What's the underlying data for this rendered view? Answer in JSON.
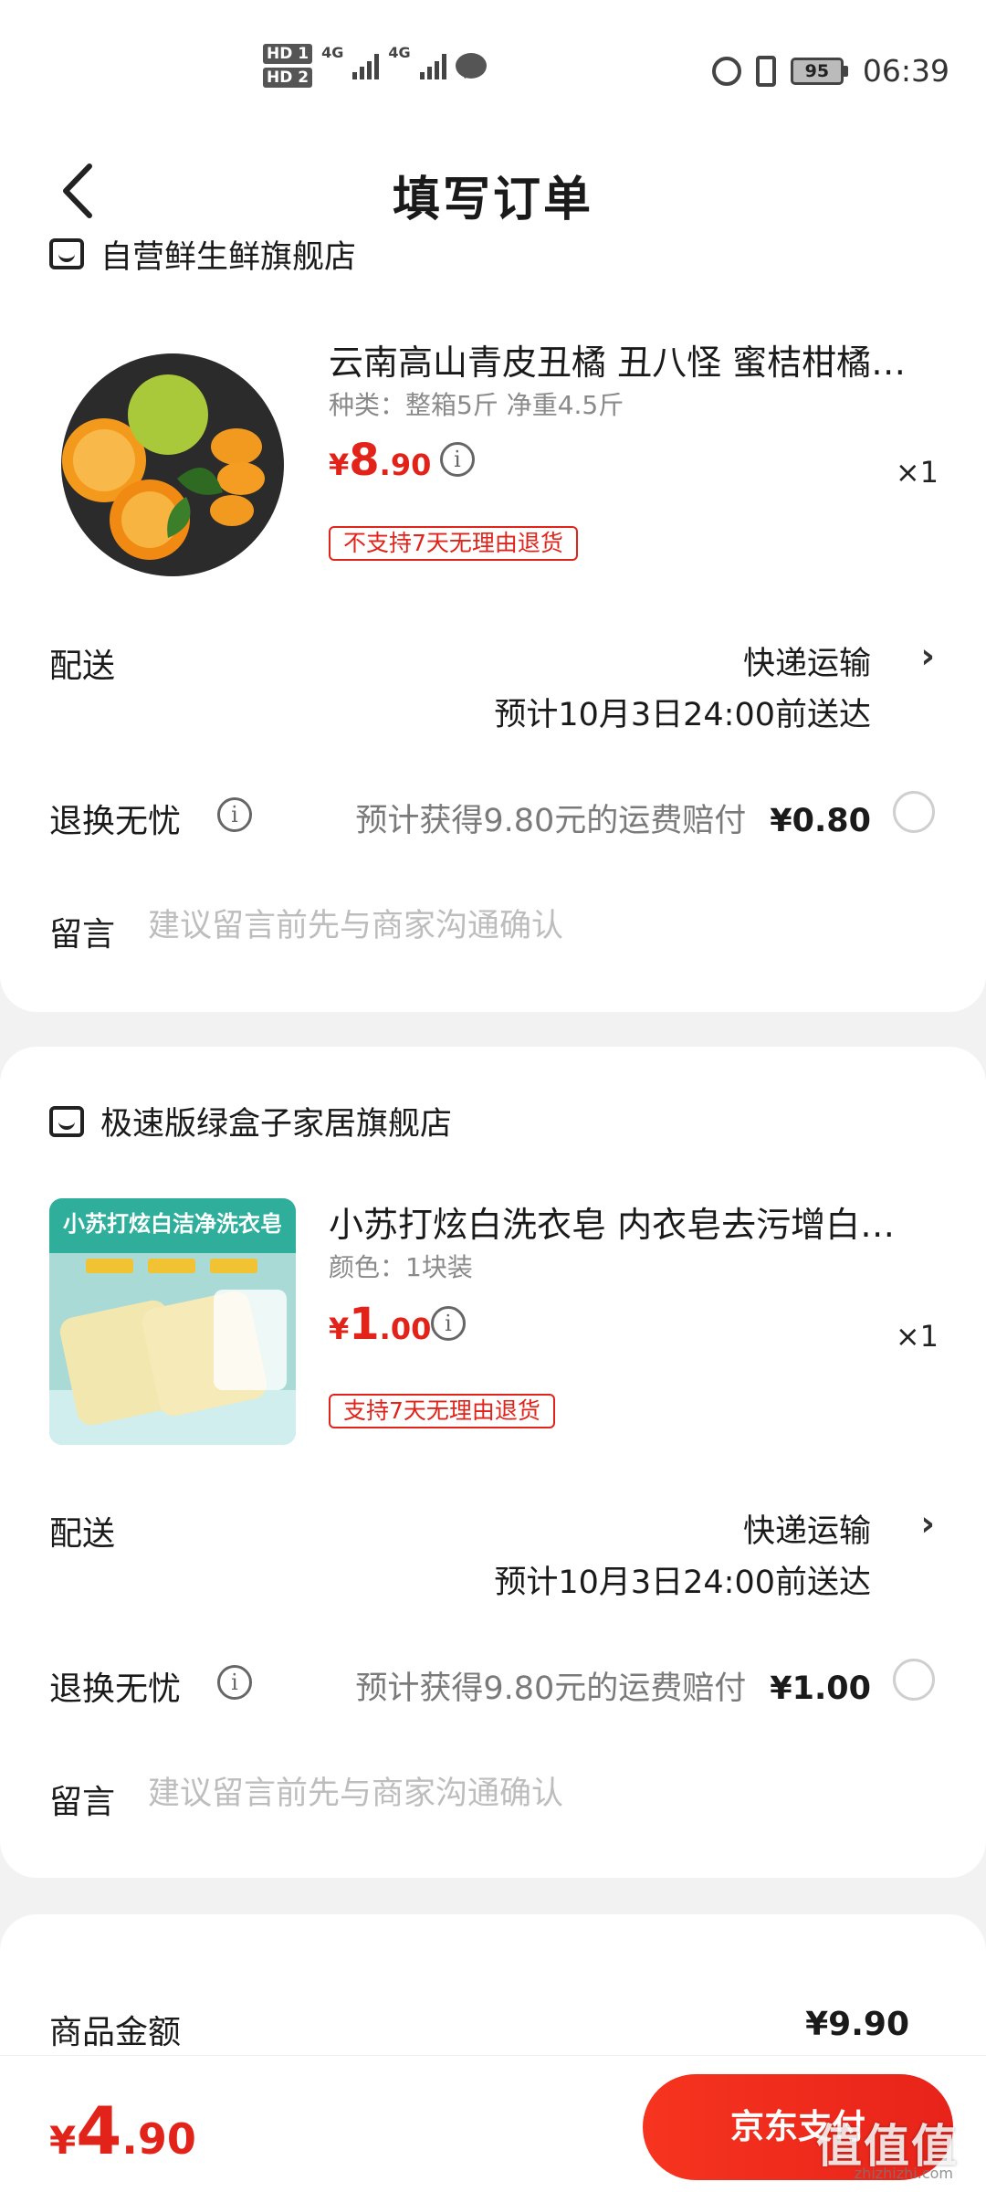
{
  "status_bar": {
    "hd1": "HD 1",
    "hd2": "HD 2",
    "net1": "4G",
    "net2": "4G",
    "battery": "95",
    "time": "06:39"
  },
  "header": {
    "title": "填写订单",
    "back_icon": "chevron-left-icon"
  },
  "orders": [
    {
      "store_name": "自营鲜生鲜旗舰店",
      "product_title": "云南高山青皮丑橘 丑八怪 蜜桔柑橘…",
      "spec": "种类：整箱5斤 净重4.5斤",
      "price_symbol": "¥",
      "price_int": "8",
      "price_dec": ".90",
      "quantity": "×1",
      "return_tag": "不支持7天无理由退货",
      "delivery_label": "配送",
      "delivery_method": "快递运输",
      "delivery_eta": "预计10月3日24:00前送达",
      "return_label": "退换无忧",
      "return_desc": "预计获得9.80元的运费赔付",
      "return_price": "¥0.80",
      "message_label": "留言",
      "message_placeholder": "建议留言前先与商家沟通确认"
    },
    {
      "store_name": "极速版绿盒子家居旗舰店",
      "product_title": "小苏打炫白洗衣皂 内衣皂去污增白…",
      "spec": "颜色：1块装",
      "price_symbol": "¥",
      "price_int": "1",
      "price_dec": ".00",
      "quantity": "×1",
      "return_tag": "支持7天无理由退货",
      "image_caption": "小苏打炫白洁净洗衣皂",
      "delivery_label": "配送",
      "delivery_method": "快递运输",
      "delivery_eta": "预计10月3日24:00前送达",
      "return_label": "退换无忧",
      "return_desc": "预计获得9.80元的运费赔付",
      "return_price": "¥1.00",
      "message_label": "留言",
      "message_placeholder": "建议留言前先与商家沟通确认"
    }
  ],
  "summary": {
    "goods_amount_label": "商品金额",
    "goods_amount_value": "¥9.90"
  },
  "footer": {
    "total_symbol": "¥",
    "total_int": "4",
    "total_dec": ".90",
    "pay_button": "京东支付",
    "watermark": "值值值",
    "watermark_sub": "zhizhizhi.com"
  },
  "colors": {
    "accent": "#e2231a",
    "background": "#f2f2f2"
  }
}
